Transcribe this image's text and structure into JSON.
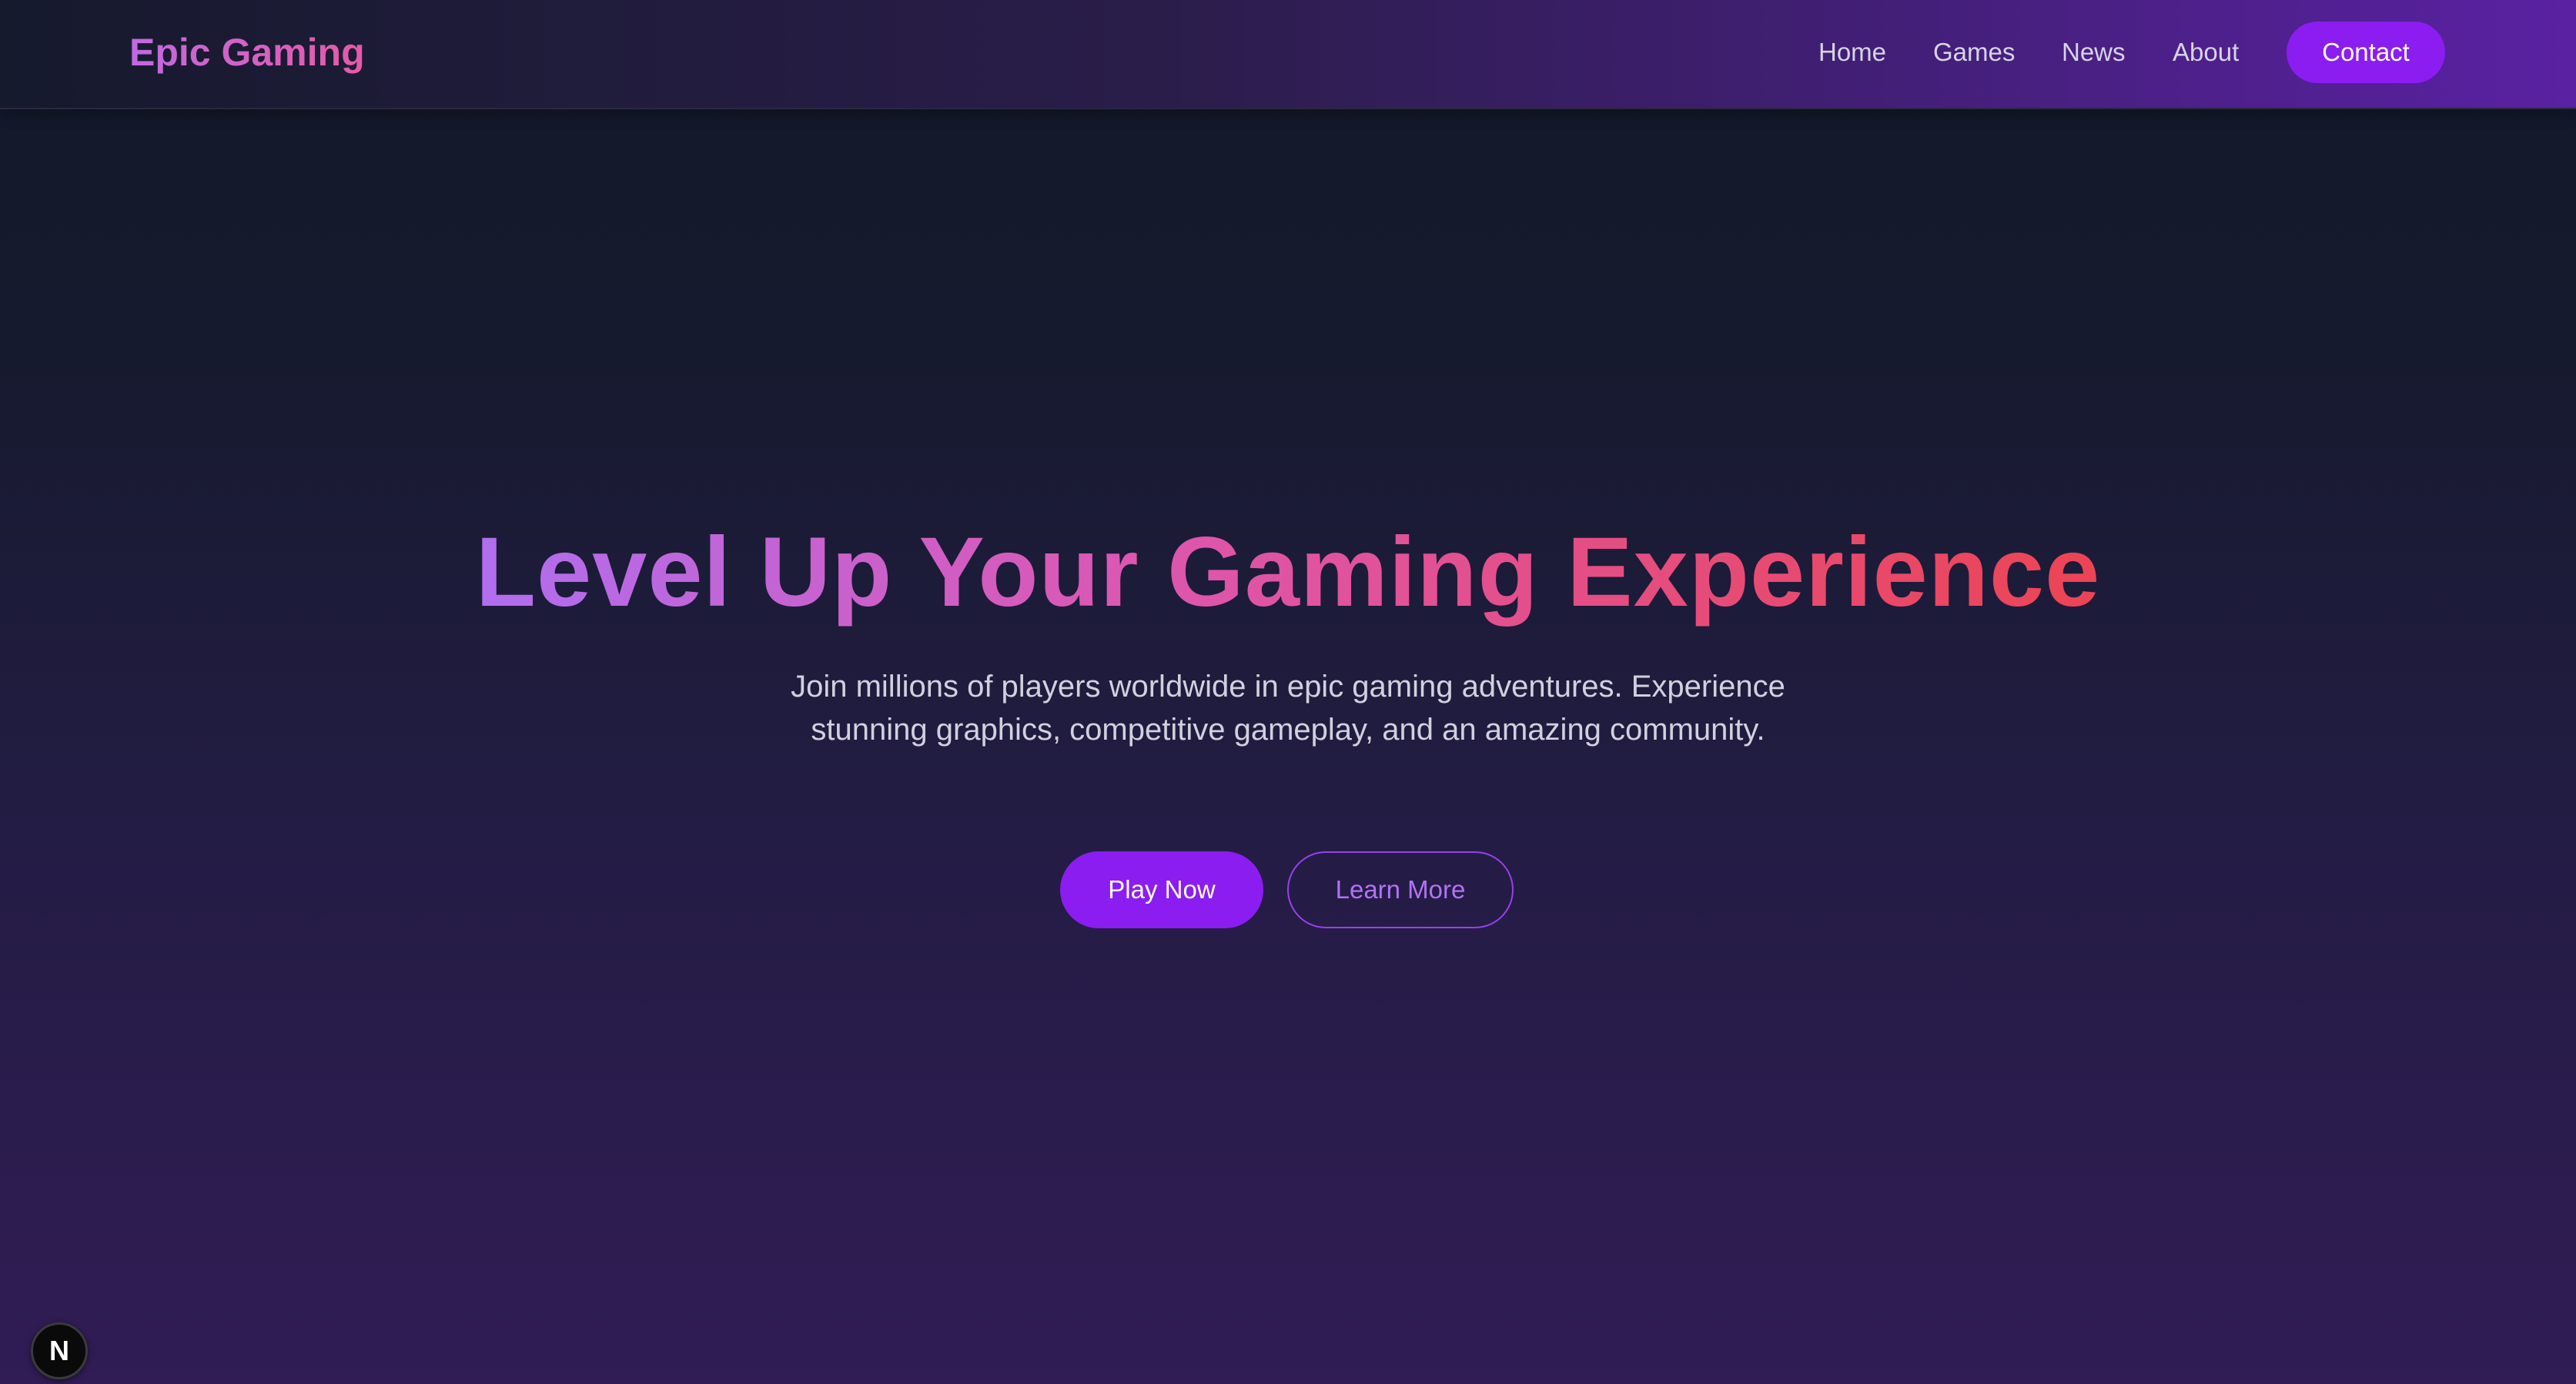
{
  "header": {
    "logo": "Epic Gaming",
    "nav": [
      {
        "label": "Home"
      },
      {
        "label": "Games"
      },
      {
        "label": "News"
      },
      {
        "label": "About"
      }
    ],
    "contact_label": "Contact"
  },
  "hero": {
    "title": "Level Up Your Gaming Experience",
    "subtitle": "Join millions of players worldwide in epic gaming adventures. Experience stunning graphics, competitive gameplay, and an amazing community.",
    "primary_label": "Play Now",
    "secondary_label": "Learn More"
  },
  "badge": {
    "letter": "N",
    "icon": "nextjs-logo-icon"
  },
  "colors": {
    "accent": "#8b1df0",
    "outline": "#9a3ef0",
    "gradient_start": "#b06ef0",
    "gradient_end": "#ec4453"
  }
}
